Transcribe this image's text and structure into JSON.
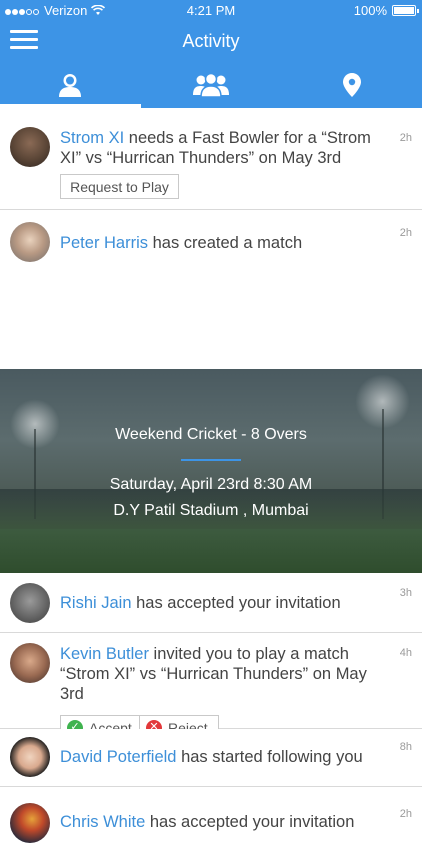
{
  "status_bar": {
    "carrier": "Verizon",
    "time": "4:21 PM",
    "battery": "100%"
  },
  "header": {
    "title": "Activity",
    "tabs": [
      {
        "name": "person-icon",
        "active": true
      },
      {
        "name": "group-icon",
        "active": false
      },
      {
        "name": "location-pin-icon",
        "active": false
      }
    ],
    "color": "#3d94e6"
  },
  "feed": [
    {
      "name": "Strom XI",
      "text": " needs a Fast Bowler for a “Strom XI” vs “Hurrican Thunders” on May 3rd",
      "time": "2h",
      "action_label": "Request to Play"
    },
    {
      "name": "Peter Harris",
      "text": " has created a match",
      "time": "2h",
      "match": {
        "title": "Weekend Cricket - 8 Overs",
        "date": "Saturday, April 23rd 8:30 AM",
        "venue": "D.Y Patil Stadium , Mumbai"
      }
    },
    {
      "name": "Rishi Jain",
      "text": " has accepted your invitation",
      "time": "3h"
    },
    {
      "name": "Kevin Butler",
      "text": " invited you to play a match “Strom XI” vs “Hurrican Thunders” on May 3rd",
      "time": "4h",
      "accept_label": "Accept",
      "reject_label": "Reject"
    },
    {
      "name": "David Poterfield",
      "text": " has started following you",
      "time": "8h"
    },
    {
      "name": "Chris White",
      "text": " has accepted your invitation",
      "time": "2h"
    }
  ]
}
